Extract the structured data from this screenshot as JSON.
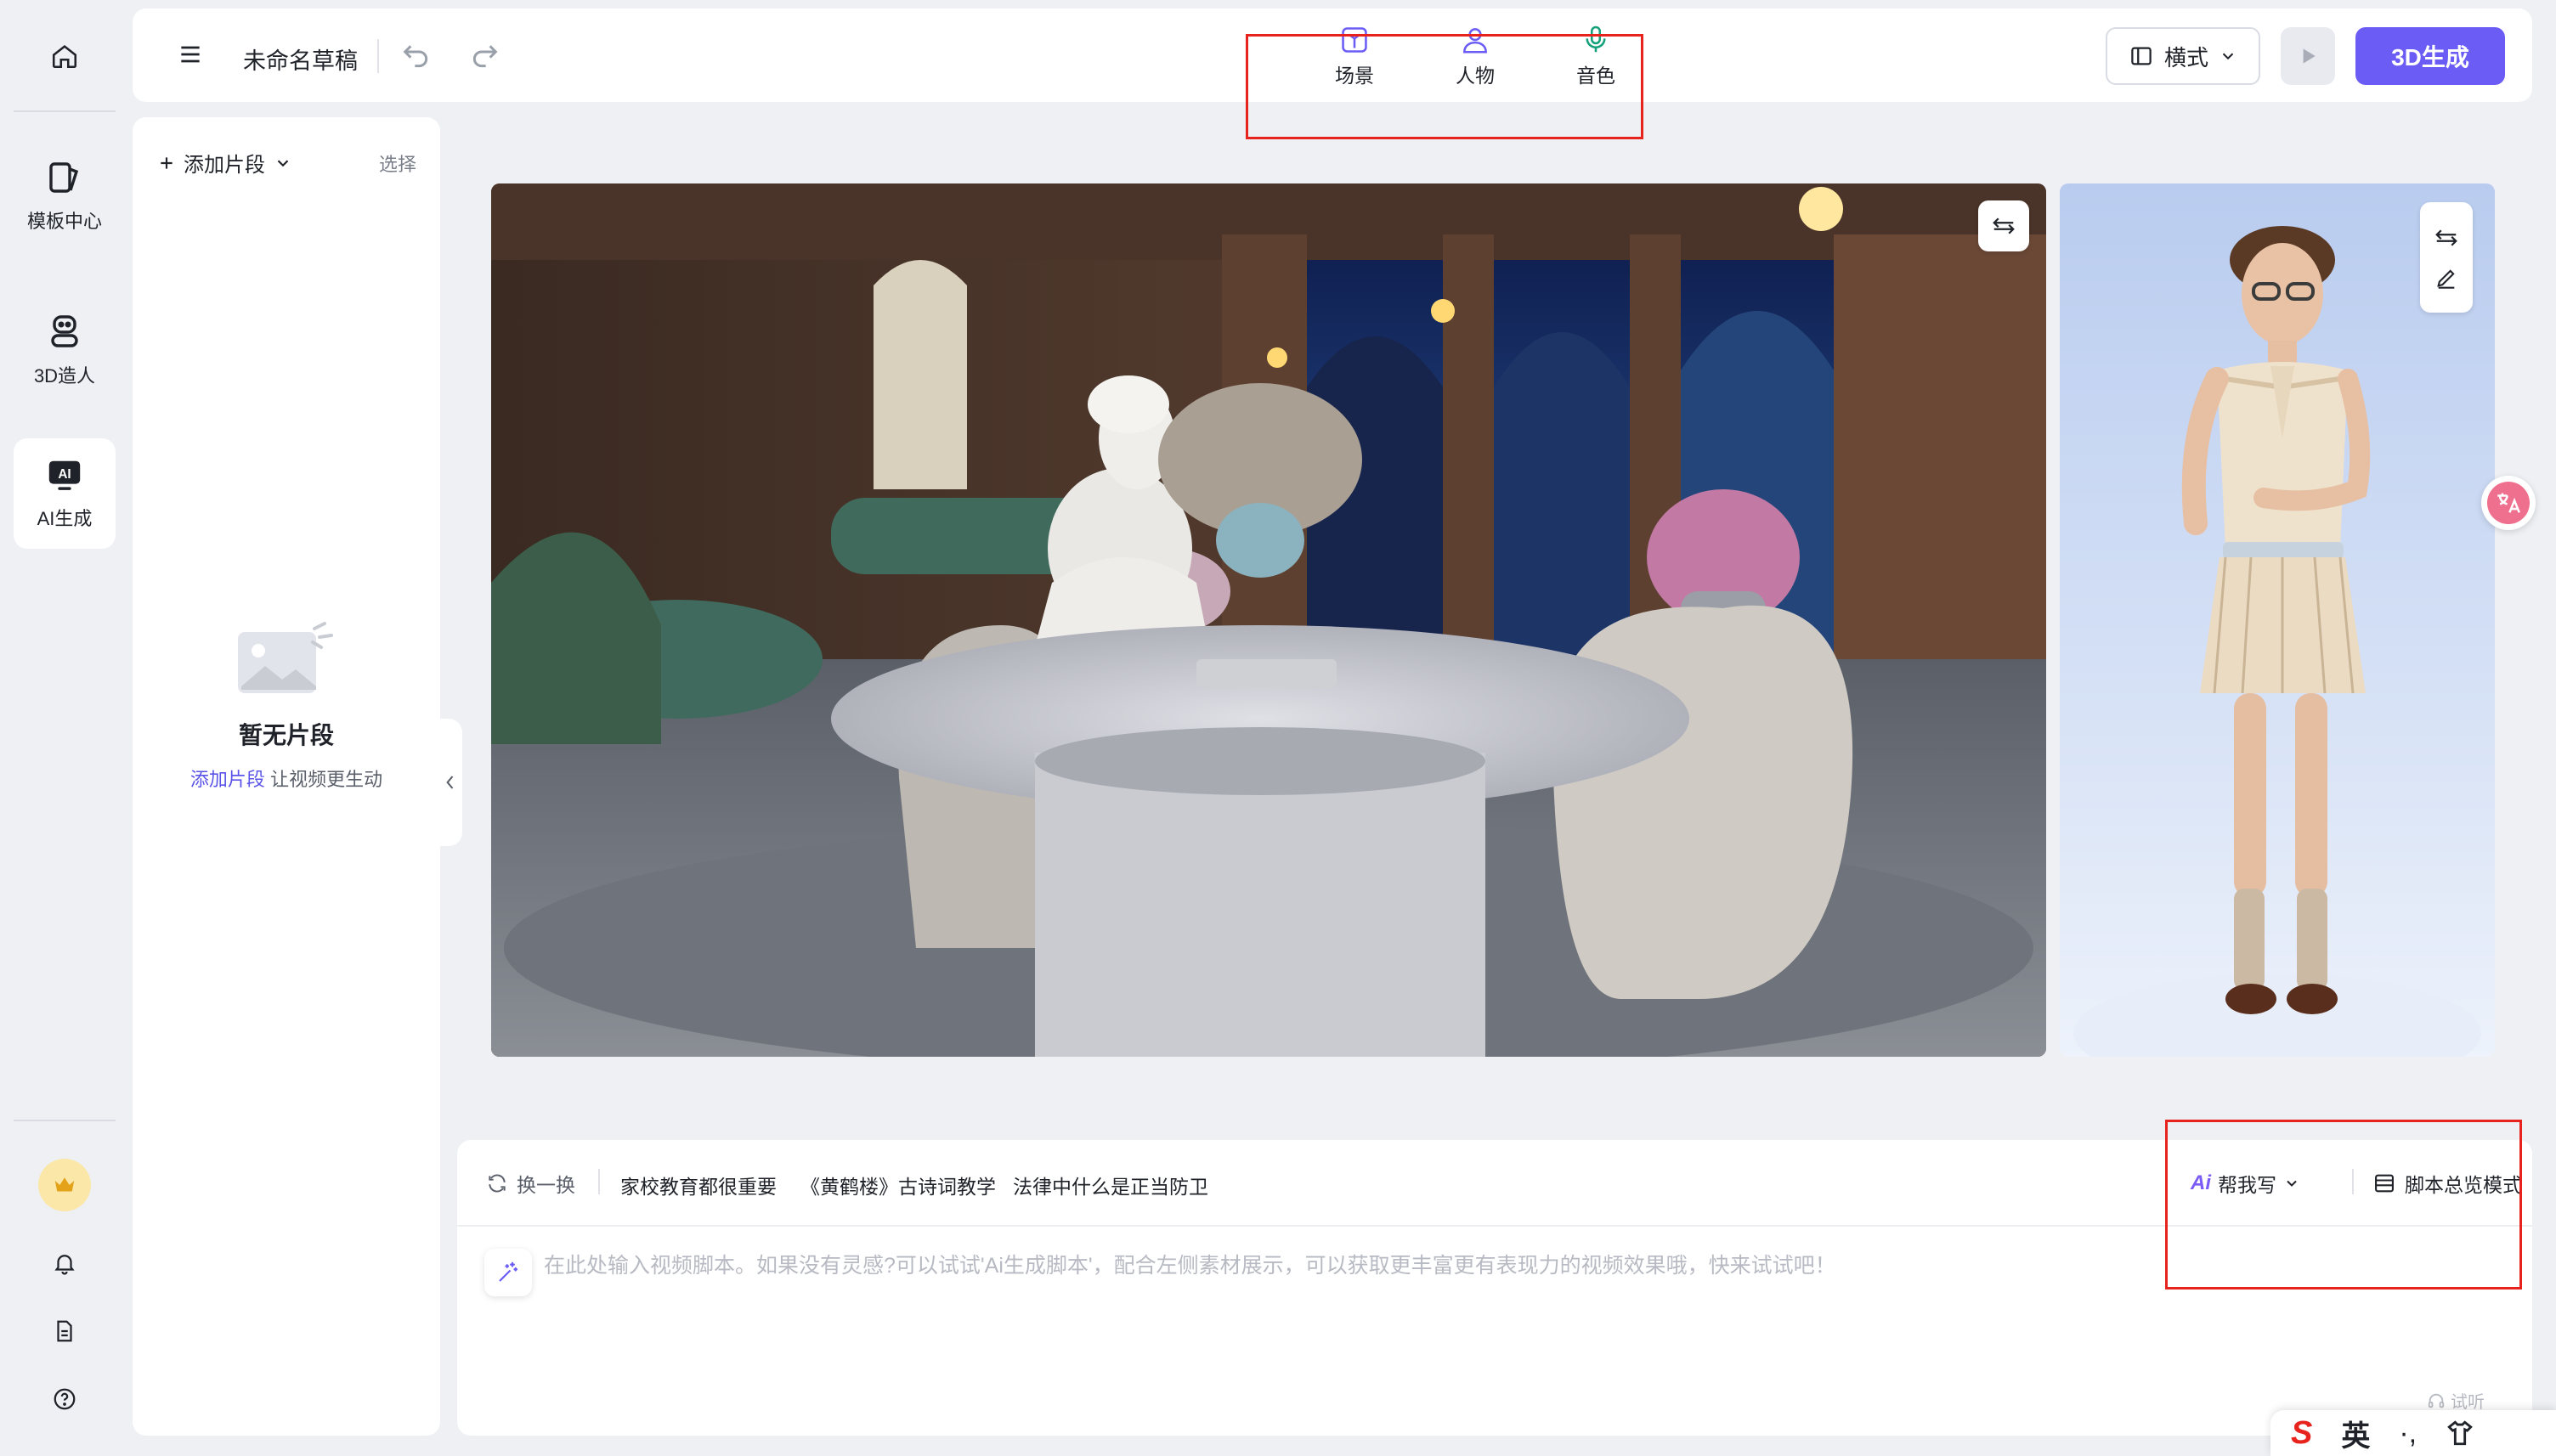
{
  "rail": {
    "items": [
      {
        "label": "",
        "icon": "home-icon"
      },
      {
        "label": "模板中心",
        "icon": "template-icon"
      },
      {
        "label": "3D造人",
        "icon": "robot-icon"
      },
      {
        "label": "AI生成",
        "icon": "ai-screen-icon"
      }
    ],
    "bottom_icons": [
      "crown-icon",
      "bell-icon",
      "document-icon",
      "help-icon"
    ]
  },
  "header": {
    "title": "未命名草稿",
    "tools": [
      {
        "label": "场景",
        "icon": "scene-icon"
      },
      {
        "label": "人物",
        "icon": "person-icon"
      },
      {
        "label": "音色",
        "icon": "microphone-icon"
      }
    ],
    "mode_label": "横式",
    "generate_label": "3D生成"
  },
  "left_panel": {
    "add_label": "添加片段",
    "select_label": "选择",
    "empty_title": "暂无片段",
    "empty_link": "添加片段",
    "empty_hint": "让视频更生动"
  },
  "script": {
    "refresh_label": "换一换",
    "suggestions": [
      "家校教育都很重要",
      "《黄鹤楼》古诗词教学",
      "法律中什么是正当防卫"
    ],
    "ai_write_label": "帮我写",
    "ai_badge": "Ai",
    "overview_label": "脚本总览模式",
    "placeholder": "在此处输入视频脚本。如果没有灵感?可以试试'Ai生成脚本'，配合左侧素材展示，可以获取更丰富更有表现力的视频效果哦，快来试试吧！",
    "listen_label": "试听"
  },
  "ime_bar": {
    "lang_label": "英"
  },
  "colors": {
    "accent": "#6a5cf5",
    "highlight": "#e8231e",
    "link": "#5b54e8"
  }
}
